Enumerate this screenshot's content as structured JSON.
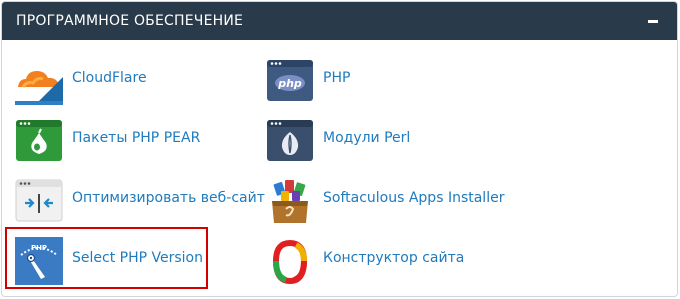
{
  "section": {
    "title": "ПРОГРАММНОЕ ОБЕСПЕЧЕНИЕ",
    "collapse_icon": "minus-icon"
  },
  "items": [
    {
      "label": "CloudFlare",
      "icon": "cloudflare-icon"
    },
    {
      "label": "PHP",
      "icon": "php-icon"
    },
    {
      "label": "Пакеты PHP PEAR",
      "icon": "php-pear-icon"
    },
    {
      "label": "Модули Perl",
      "icon": "perl-modules-icon"
    },
    {
      "label": "Оптимизировать веб-сайт",
      "icon": "optimize-website-icon"
    },
    {
      "label": "Softaculous Apps Installer",
      "icon": "softaculous-icon"
    },
    {
      "label": "Select PHP Version",
      "icon": "select-php-version-icon"
    },
    {
      "label": "Конструктор сайта",
      "icon": "site-builder-icon"
    }
  ],
  "colors": {
    "header_bg": "#293a4a",
    "link": "#1f7bbd",
    "highlight_border": "#d40000"
  }
}
